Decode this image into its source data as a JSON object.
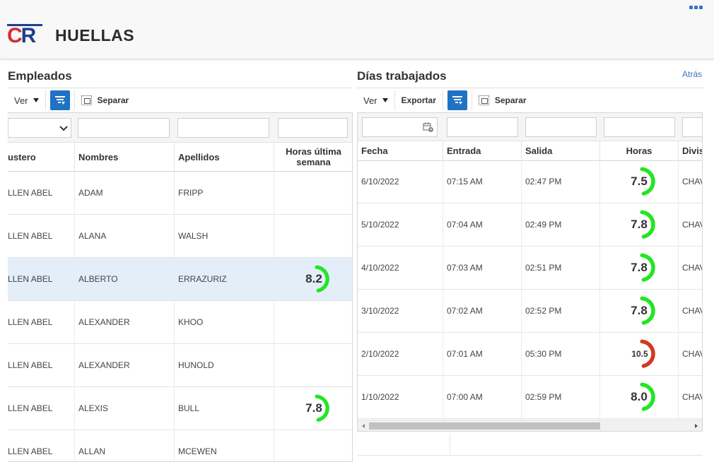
{
  "app": {
    "title": "HUELLAS",
    "logo_c": "C",
    "logo_r": "R"
  },
  "empleados": {
    "title": "Empleados",
    "toolbar": {
      "view_label": "Ver",
      "detach_label": "Separar"
    },
    "columns": [
      "ustero",
      "Nombres",
      "Apellidos",
      "Horas última semana"
    ],
    "rows": [
      {
        "c1": "LLEN ABEL",
        "nombres": "ADAM",
        "apellidos": "FRIPP",
        "horas": ""
      },
      {
        "c1": "LLEN ABEL",
        "nombres": "ALANA",
        "apellidos": "WALSH",
        "horas": ""
      },
      {
        "c1": "LLEN ABEL",
        "nombres": "ALBERTO",
        "apellidos": "ERRAZURIZ",
        "horas": "8.2"
      },
      {
        "c1": "LLEN ABEL",
        "nombres": "ALEXANDER",
        "apellidos": "KHOO",
        "horas": ""
      },
      {
        "c1": "LLEN ABEL",
        "nombres": "ALEXANDER",
        "apellidos": "HUNOLD",
        "horas": ""
      },
      {
        "c1": "LLEN ABEL",
        "nombres": "ALEXIS",
        "apellidos": "BULL",
        "horas": "7.8"
      },
      {
        "c1": "LLEN ABEL",
        "nombres": "ALLAN",
        "apellidos": "MCEWEN",
        "horas": ""
      }
    ],
    "selected_row": 2
  },
  "dias": {
    "title": "Días trabajados",
    "back_label": "Atrás",
    "toolbar": {
      "view_label": "Ver",
      "export_label": "Exportar",
      "detach_label": "Separar"
    },
    "columns": [
      "Fecha",
      "Entrada",
      "Salida",
      "Horas",
      "Divis"
    ],
    "rows": [
      {
        "fecha": "6/10/2022",
        "entrada": "07:15 AM",
        "salida": "02:47 PM",
        "horas": "7.5",
        "division": "CHAV",
        "status": "ok"
      },
      {
        "fecha": "5/10/2022",
        "entrada": "07:04 AM",
        "salida": "02:49 PM",
        "horas": "7.8",
        "division": "CHAV",
        "status": "ok"
      },
      {
        "fecha": "4/10/2022",
        "entrada": "07:03 AM",
        "salida": "02:51 PM",
        "horas": "7.8",
        "division": "CHAV",
        "status": "ok"
      },
      {
        "fecha": "3/10/2022",
        "entrada": "07:02 AM",
        "salida": "02:52 PM",
        "horas": "7.8",
        "division": "CHAV",
        "status": "ok"
      },
      {
        "fecha": "2/10/2022",
        "entrada": "07:01 AM",
        "salida": "05:30 PM",
        "horas": "10.5",
        "division": "CHAV",
        "status": "over"
      },
      {
        "fecha": "1/10/2022",
        "entrada": "07:00 AM",
        "salida": "02:59 PM",
        "horas": "8.0",
        "division": "CHAV",
        "status": "ok"
      }
    ]
  },
  "colors": {
    "gauge_ok": "#22e622",
    "gauge_over": "#d23a1e",
    "accent": "#1f72c4",
    "link": "#3b73c4",
    "selected_row": "#e3eef8"
  },
  "icons": [
    "filter-icon",
    "detach-icon",
    "calendar-icon",
    "dropdown-chevron-icon",
    "caret-down-icon"
  ]
}
